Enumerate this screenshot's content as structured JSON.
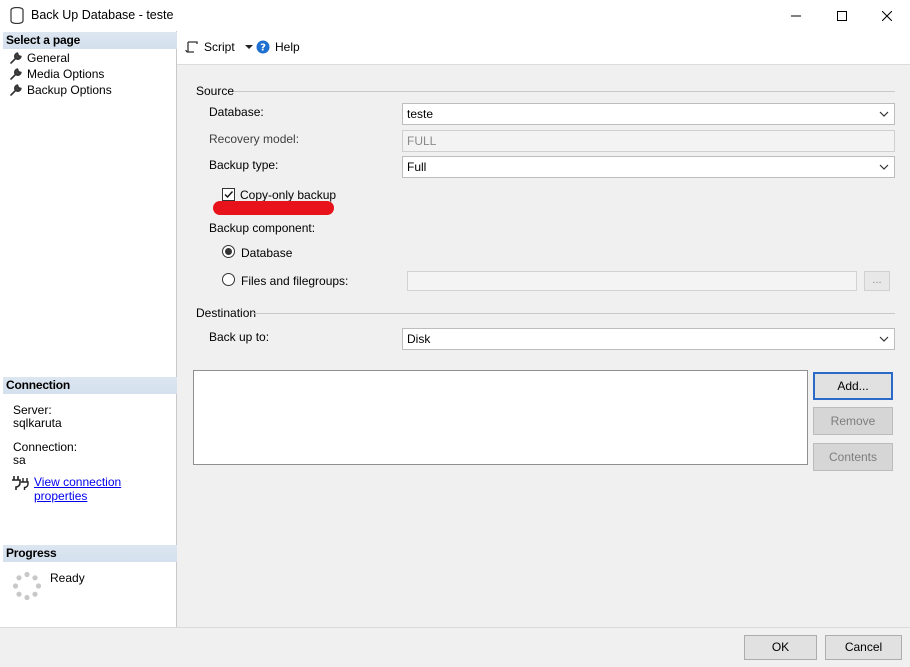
{
  "window": {
    "title": "Back Up Database - teste"
  },
  "left": {
    "select_page_header": "Select a page",
    "pages": [
      {
        "label": "General"
      },
      {
        "label": "Media Options"
      },
      {
        "label": "Backup Options"
      }
    ],
    "connection_header": "Connection",
    "server_label": "Server:",
    "server_value": "sqlkaruta",
    "connection_label": "Connection:",
    "connection_value": "sa",
    "view_connection_link": "View connection properties",
    "progress_header": "Progress",
    "progress_status": "Ready"
  },
  "toolbar": {
    "script_label": "Script",
    "help_label": "Help"
  },
  "source": {
    "group_title": "Source",
    "database_label": "Database:",
    "database_value": "teste",
    "recovery_label": "Recovery model:",
    "recovery_value": "FULL",
    "backup_type_label": "Backup type:",
    "backup_type_value": "Full",
    "copy_only_label": "Copy-only backup",
    "copy_only_checked": true,
    "component_label": "Backup component:",
    "component_database_label": "Database",
    "component_files_label": "Files and filegroups:",
    "browse_label": "..."
  },
  "destination": {
    "group_title": "Destination",
    "backup_to_label": "Back up to:",
    "backup_to_value": "Disk",
    "add_label": "Add...",
    "remove_label": "Remove",
    "contents_label": "Contents"
  },
  "footer": {
    "ok_label": "OK",
    "cancel_label": "Cancel"
  },
  "colors": {
    "accent": "#2a6ac8",
    "header_bg": "#dce6f1",
    "highlight_mark": "#e8131a"
  }
}
